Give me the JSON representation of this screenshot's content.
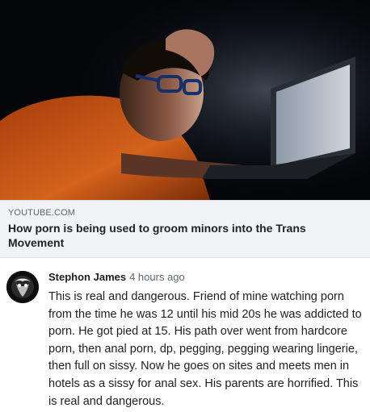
{
  "link": {
    "domain": "YOUTUBE.COM",
    "title": "How porn is being used to groom minors into the Trans Movement"
  },
  "comment": {
    "author": "Stephon James",
    "time": "4 hours ago",
    "text": "This is real and dangerous. Friend of mine watching porn from the time he was 12 until his mid 20s he was addicted to porn. He got pied at 15. His path over went from hardcore porn, then anal porn, dp, pegging, pegging wearing lingerie, then full on sissy. Now he goes on sites and meets men in hotels as a sissy for anal sex. His parents are horrified. This is real and dangerous."
  }
}
